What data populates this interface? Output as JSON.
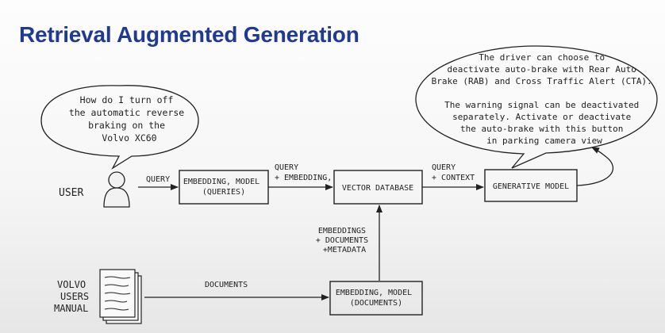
{
  "title": "Retrieval Augmented Generation",
  "question_bubble": {
    "lines": [
      "How do I turn off",
      "the automatic reverse",
      "braking on the",
      "Volvo XC60"
    ]
  },
  "answer_bubble": {
    "lines": [
      "The driver can choose to",
      "deactivate  auto-brake with Rear Auto",
      "Brake (RAB) and Cross Traffic Alert (CTA).",
      "",
      "The warning signal can be deactivated",
      "separately. Activate or deactivate",
      "the auto-brake with this button",
      "in parking camera view"
    ]
  },
  "actors": {
    "user": "USER",
    "manual": [
      "VOLVO",
      "USERS",
      "MANUAL"
    ]
  },
  "boxes": {
    "embedding_queries": [
      "EMBEDDING, MODEL",
      "(QUERIES)"
    ],
    "vector_db": "VECTOR DATABASE",
    "generative": "GENERATIVE MODEL",
    "embedding_documents": [
      "EMBEDDING, MODEL",
      "(DOCUMENTS)"
    ]
  },
  "edge_labels": {
    "query": "QUERY",
    "query_embedding": [
      "QUERY",
      "+ EMBEDDING,"
    ],
    "query_context": [
      "QUERY",
      "+ CONTEXT"
    ],
    "embeddings_docs_meta": [
      "EMBEDDINGS",
      "+ DOCUMENTS",
      "+METADATA"
    ],
    "documents": "DOCUMENTS"
  },
  "colors": {
    "title": "#1f3a8f",
    "ink": "#222222"
  }
}
